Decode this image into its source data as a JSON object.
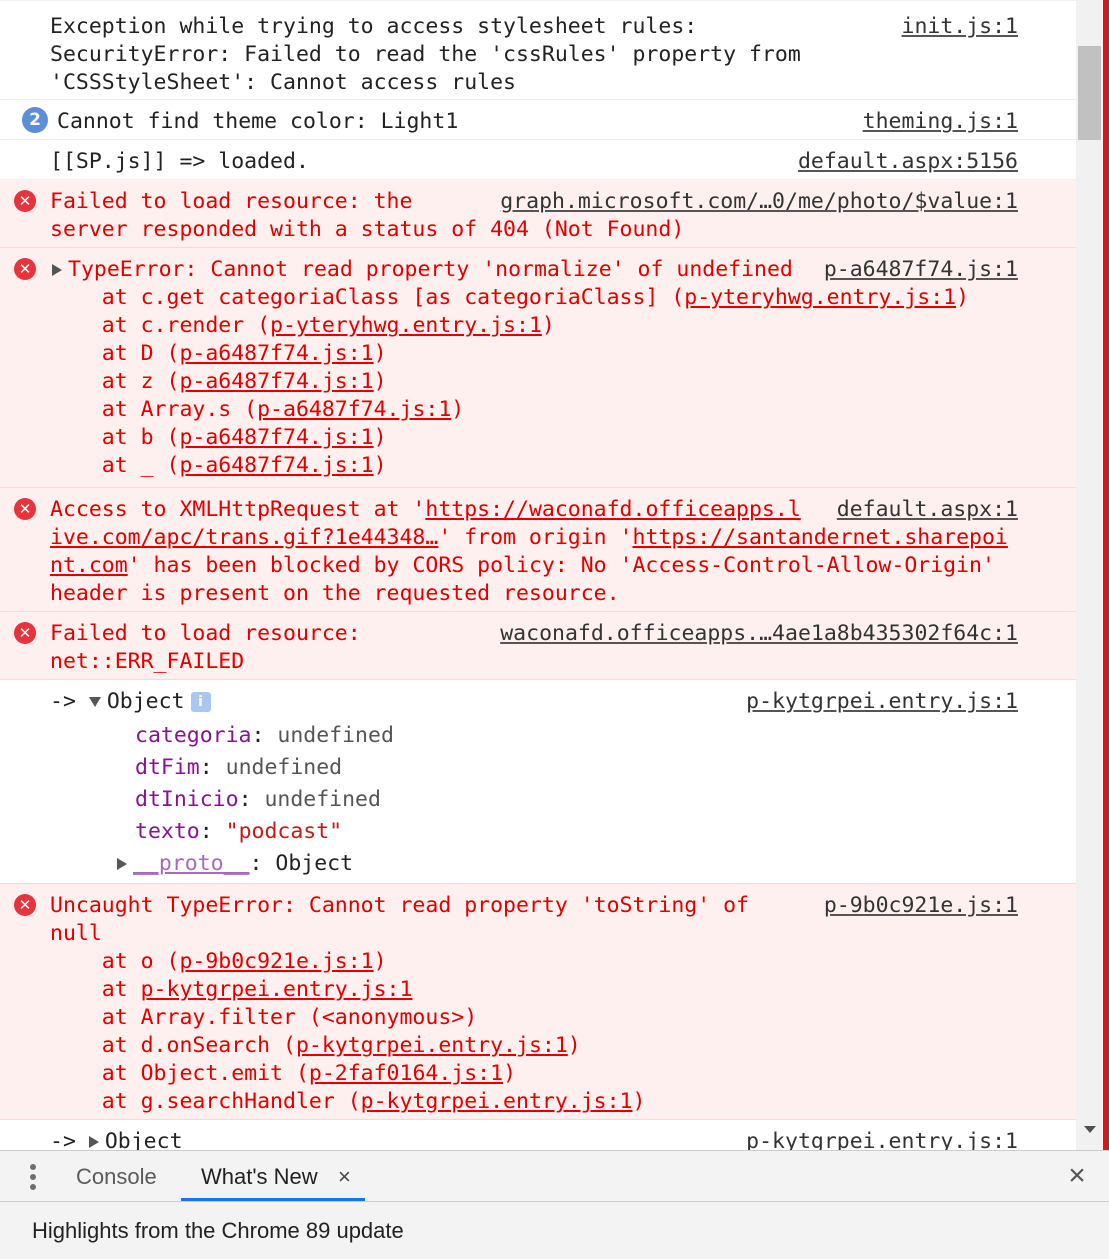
{
  "console": {
    "messages": [
      {
        "level": "log",
        "lines": [
          "Exception while trying to access stylesheet rules:",
          "SecurityError: Failed to read the 'cssRules' property from",
          "'CSSStyleSheet': Cannot access rules"
        ],
        "source": "init.js:1"
      },
      {
        "level": "log",
        "repeat_count": "2",
        "lines": [
          "Cannot find theme color: Light1"
        ],
        "source": "theming.js:1"
      },
      {
        "level": "log",
        "lines": [
          "[[SP.js]] => loaded."
        ],
        "source": "default.aspx:5156"
      },
      {
        "level": "error",
        "lines": [
          "Failed to load resource: the",
          "server responded with a status of 404 (Not Found)"
        ],
        "source": "graph.microsoft.com/…0/me/photo/$value:1"
      },
      {
        "level": "error",
        "expandable": true,
        "lines": [
          "TypeError: Cannot read property 'normalize' of undefined",
          "    at c.get categoriaClass [as categoriaClass] (",
          "    at c.render (",
          "    at D (",
          "    at z (",
          "    at Array.s (",
          "    at b (",
          "    at _ ("
        ],
        "links": [
          "p-yteryhwg.entry.js:1",
          "p-yteryhwg.entry.js:1",
          "p-a6487f74.js:1",
          "p-a6487f74.js:1",
          "p-a6487f74.js:1",
          "p-a6487f74.js:1",
          "p-a6487f74.js:1"
        ],
        "source": "p-a6487f74.js:1"
      },
      {
        "level": "error",
        "lines": [
          "Access to XMLHttpRequest at '",
          "https://waconafd.officeapps.l",
          "ive.com/apc/trans.gif?1e44348…",
          "' from origin '",
          "https://santandernet.sharepoi",
          "nt.com",
          "' has been blocked by CORS policy: No 'Access-Control-Allow-Origin'",
          "header is present on the requested resource."
        ],
        "source": "default.aspx:1"
      },
      {
        "level": "error",
        "lines": [
          "Failed to load resource:",
          "net::ERR_FAILED"
        ],
        "source": "waconafd.officeapps.…4ae1a8b435302f64c:1"
      },
      {
        "level": "log",
        "prefix": "-> ",
        "object_label": "Object",
        "info_icon": "i",
        "properties": [
          {
            "key": "categoria",
            "value": "undefined"
          },
          {
            "key": "dtFim",
            "value": "undefined"
          },
          {
            "key": "dtInicio",
            "value": "undefined"
          },
          {
            "key": "texto",
            "value": "\"podcast\""
          }
        ],
        "proto_key": "__proto__",
        "proto_value": "Object",
        "source": "p-kytgrpei.entry.js:1"
      },
      {
        "level": "error",
        "lines": [
          "Uncaught TypeError: Cannot read property 'toString' of",
          "null",
          "    at o (",
          "    at ",
          "    at Array.filter (",
          "    at d.onSearch (",
          "    at Object.emit (",
          "    at g.searchHandler ("
        ],
        "links": [
          "p-9b0c921e.js:1",
          "p-kytgrpei.entry.js:1",
          "<anonymous>",
          "p-kytgrpei.entry.js:1",
          "p-2faf0164.js:1",
          "p-kytgrpei.entry.js:1"
        ],
        "source": "p-9b0c921e.js:1"
      },
      {
        "level": "log",
        "prefix": "-> ",
        "object_label": "Object",
        "source": "p-kytgrpei.entry.js:1"
      }
    ]
  },
  "drawer": {
    "tabs": [
      "Console",
      "What's New"
    ],
    "tab_close_glyph": "×",
    "close_glyph": "×",
    "heading": "Highlights from the Chrome 89 update"
  },
  "colors": {
    "error_text": "#e00000",
    "error_bg": "#fff0f0",
    "accent": "#1a73e8"
  }
}
